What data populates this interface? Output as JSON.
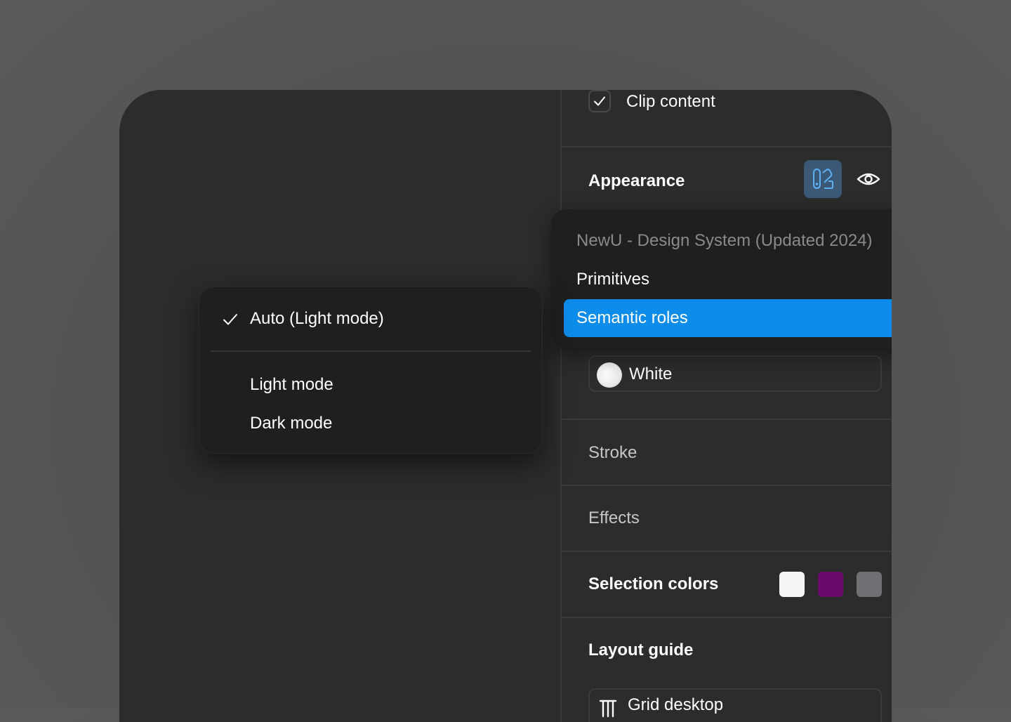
{
  "panel": {
    "clip_content": {
      "label": "Clip content",
      "checked": true
    },
    "appearance": {
      "title": "Appearance",
      "variable_mode_icon": "variable-mode-icon",
      "visibility_icon": "eye-icon"
    },
    "fill": {
      "value": "White",
      "swatch_color": "#ffffff"
    },
    "stroke": {
      "title": "Stroke"
    },
    "effects": {
      "title": "Effects"
    },
    "selection_colors": {
      "title": "Selection colors",
      "swatches": [
        "#f5f5f5",
        "#6b0a6b",
        "#6e7073"
      ]
    },
    "layout_guide": {
      "title": "Layout guide",
      "item": "Grid desktop",
      "icon": "grid-columns-icon"
    }
  },
  "library_menu": {
    "header": "NewU - Design System (Updated 2024)",
    "items": [
      "Primitives",
      "Semantic roles"
    ],
    "selected": "Semantic roles",
    "accent": "#0d8ce9"
  },
  "mode_menu": {
    "checked_item": "Auto (Light mode)",
    "items": [
      "Light mode",
      "Dark mode"
    ]
  }
}
